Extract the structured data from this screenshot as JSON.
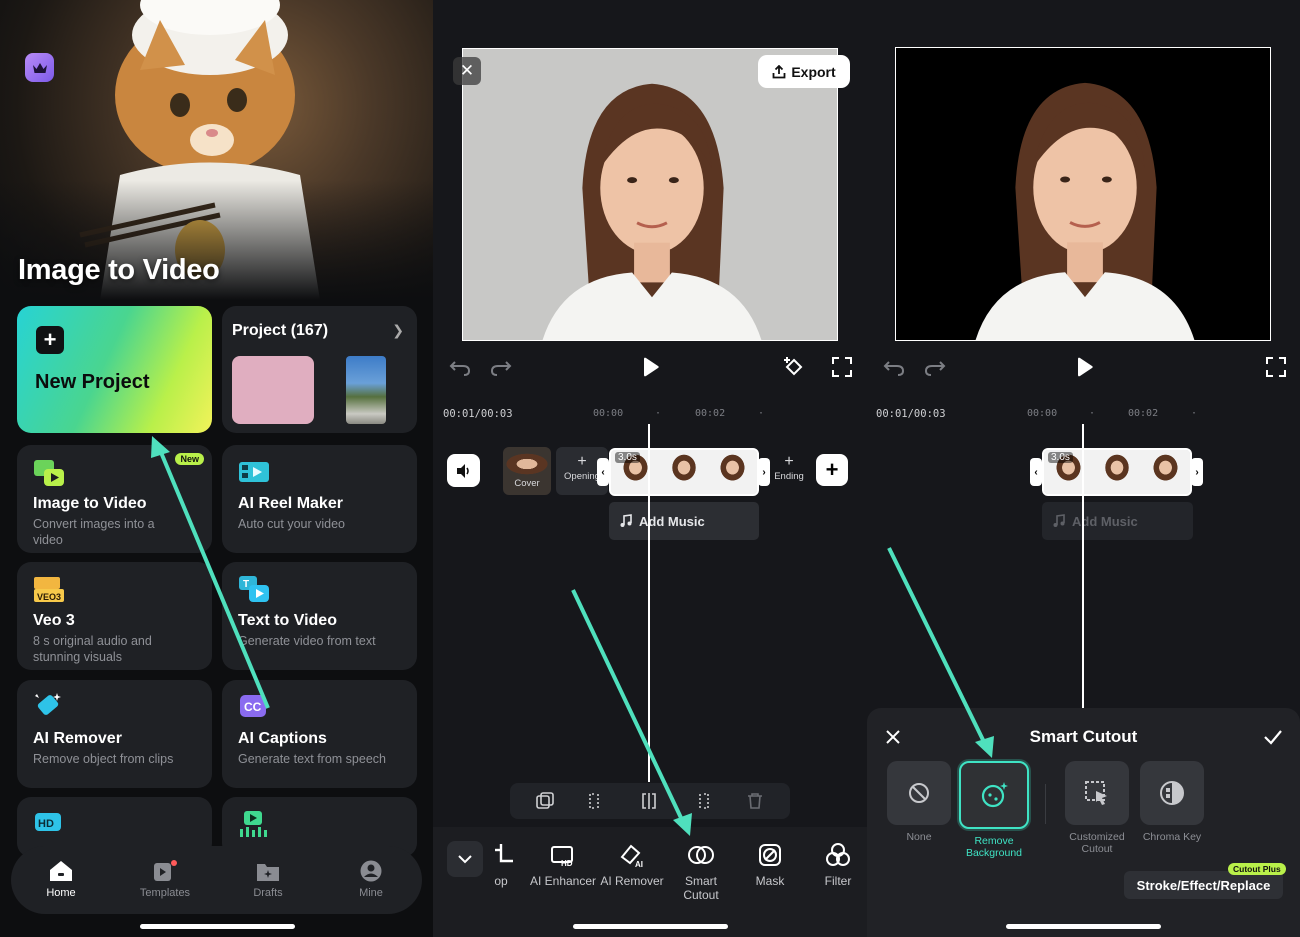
{
  "home": {
    "hero_title": "Image to Video",
    "new_project_label": "New Project",
    "project_title": "Project (167)",
    "tools": [
      {
        "title": "Image to Video",
        "desc": "Convert images into a video",
        "badge": "New"
      },
      {
        "title": "AI Reel Maker",
        "desc": "Auto cut your video"
      },
      {
        "title": "Veo 3",
        "desc": "8 s original audio and stunning visuals"
      },
      {
        "title": "Text to Video",
        "desc": "Generate video from text"
      },
      {
        "title": "AI Remover",
        "desc": "Remove object from clips"
      },
      {
        "title": "AI Captions",
        "desc": "Generate text from speech"
      }
    ],
    "nav": [
      "Home",
      "Templates",
      "Drafts",
      "Mine"
    ]
  },
  "editor": {
    "export_label": "Export",
    "timecode": "00:01/00:03",
    "ticks": [
      "00:00",
      "00:02"
    ],
    "clip_duration": "3.0s",
    "cover_label": "Cover",
    "opening_label": "Opening",
    "ending_label": "Ending",
    "add_music_label": "Add Music",
    "toolbar": [
      {
        "label": "op",
        "icon": "crop-icon"
      },
      {
        "label": "AI Enhancer",
        "icon": "hd-enhancer-icon"
      },
      {
        "label": "AI Remover",
        "icon": "ai-eraser-icon"
      },
      {
        "label": "Smart Cutout",
        "icon": "smart-cutout-icon"
      },
      {
        "label": "Mask",
        "icon": "mask-icon"
      },
      {
        "label": "Filter",
        "icon": "filter-icon"
      }
    ]
  },
  "cutout": {
    "timecode": "00:01/00:03",
    "ticks": [
      "00:00",
      "00:02"
    ],
    "clip_duration": "3.0s",
    "add_music_label": "Add Music",
    "sheet_title": "Smart Cutout",
    "options": [
      "None",
      "Remove Background",
      "Customized Cutout",
      "Chroma Key"
    ],
    "badge": "Cutout Plus",
    "stroke_label": "Stroke/Effect/Replace"
  },
  "colors": {
    "accent": "#3fe3c4",
    "badge": "#b9f04a",
    "arrow": "#4fe0bd"
  }
}
